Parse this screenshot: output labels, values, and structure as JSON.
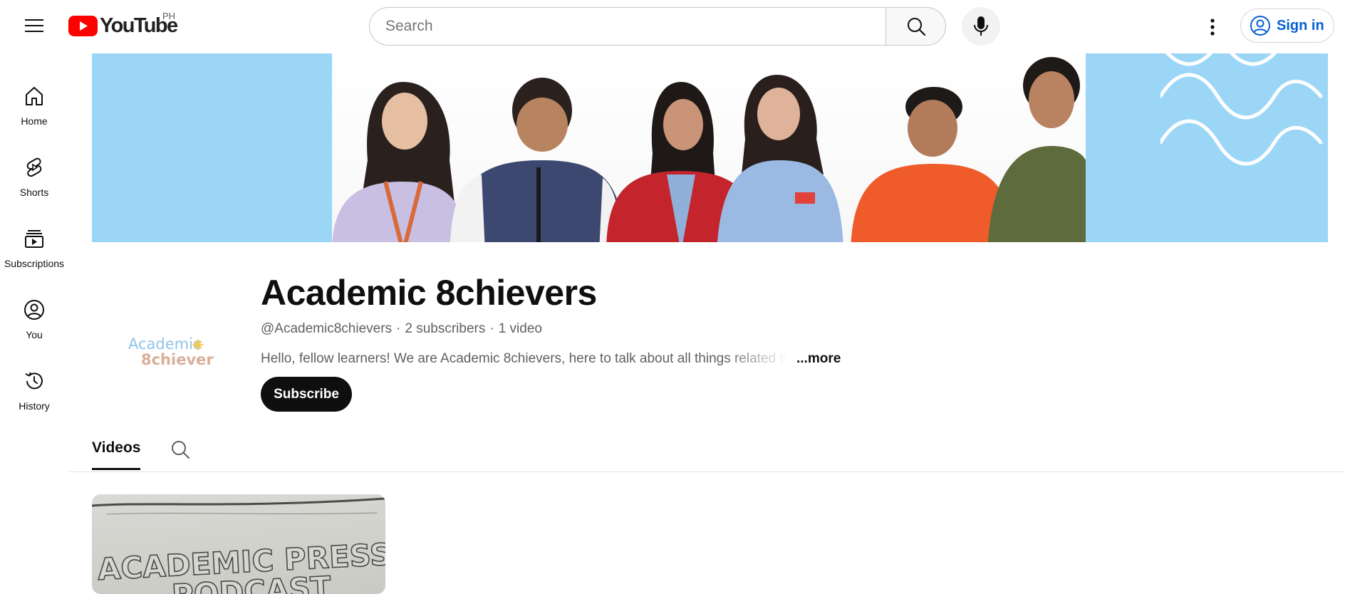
{
  "header": {
    "logo_text": "YouTube",
    "country_code": "PH",
    "search_placeholder": "Search",
    "sign_in_label": "Sign in",
    "colors": {
      "logo_red": "#ff0000",
      "sign_in_blue": "#065fd4"
    }
  },
  "guide": {
    "items": [
      {
        "label": "Home",
        "icon": "home-icon"
      },
      {
        "label": "Shorts",
        "icon": "shorts-icon"
      },
      {
        "label": "Subscriptions",
        "icon": "subscriptions-icon"
      },
      {
        "label": "You",
        "icon": "you-icon"
      },
      {
        "label": "History",
        "icon": "history-icon"
      }
    ]
  },
  "banner": {
    "background_color": "#9cd6f7"
  },
  "channel": {
    "name": "Academic 8chievers",
    "handle": "@Academic8chievers",
    "subscribers": "2 subscribers",
    "videos": "1 video",
    "description": "Hello, fellow learners! We are Academic 8chievers, here to talk about all things related to",
    "more_label": "...more",
    "subscribe_label": "Subscribe",
    "avatar_logo_line1": "Academic",
    "avatar_logo_line2": "8chievers"
  },
  "tabs": [
    {
      "label": "Videos",
      "selected": true
    }
  ],
  "videos": [
    {
      "thumbnail_text_line1": "ACADEMIC PRESSURE",
      "thumbnail_text_line2": "PODCAST"
    }
  ]
}
